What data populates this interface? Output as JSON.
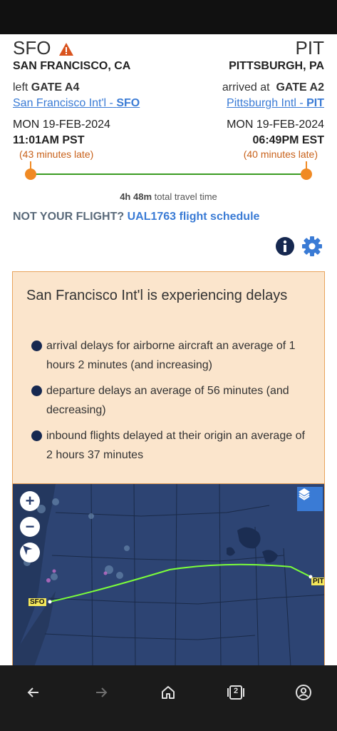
{
  "origin": {
    "code": "SFO",
    "city": "SAN FRANCISCO, CA",
    "gate_prefix": "left",
    "gate": "GATE A4",
    "airport_name": "San Francisco Int'l -",
    "airport_code": "SFO",
    "date": "MON 19-FEB-2024",
    "time": "11:01AM PST",
    "late": "(43 minutes late)"
  },
  "destination": {
    "code": "PIT",
    "city": "PITTSBURGH, PA",
    "gate_prefix": "arrived at",
    "gate": "GATE A2",
    "airport_name": "Pittsburgh Intl -",
    "airport_code": "PIT",
    "date": "MON 19-FEB-2024",
    "time": "06:49PM EST",
    "late": "(40 minutes late)"
  },
  "travel": {
    "duration": "4h 48m",
    "label": "total travel time"
  },
  "not_your_flight": {
    "prompt": "NOT YOUR FLIGHT?",
    "link": "UAL1763 flight schedule"
  },
  "alert": {
    "title": "San Francisco Int'l is experiencing delays",
    "items": [
      "arrival delays for airborne aircraft an average of 1 hours 2 minutes (and increasing)",
      "departure delays an average of 56 minutes (and decreasing)",
      "inbound flights delayed at their origin an average of 2 hours 37 minutes"
    ]
  },
  "map": {
    "origin_label": "SFO",
    "dest_label": "PIT",
    "zoom_in": "+",
    "zoom_out": "−"
  },
  "colors": {
    "link": "#3a7bd5",
    "late": "#c8611a",
    "track": "#3a9b22",
    "alert_bg": "#fbe5cc",
    "map_bg": "#2c4170",
    "route": "#7cff3a"
  },
  "icons": {
    "warning": "warning-icon",
    "info": "info-icon",
    "settings": "gear-icon",
    "layers": "layers-icon",
    "compass": "compass-icon",
    "nav_back": "back-arrow-icon",
    "nav_forward": "forward-arrow-icon",
    "nav_home": "home-icon",
    "nav_tabs": "tabs-icon",
    "nav_account": "account-icon"
  },
  "nav": {
    "tabs_count": "2"
  }
}
